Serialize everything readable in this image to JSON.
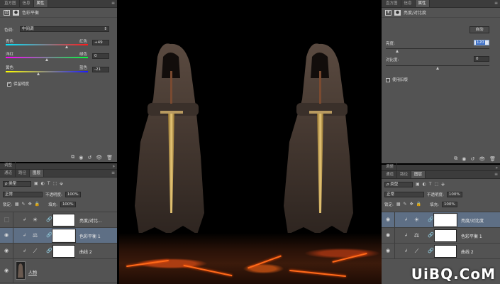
{
  "left_properties": {
    "tabs": [
      "直方图",
      "信息",
      "属性"
    ],
    "header": "色彩平衡",
    "tone_label": "色调:",
    "tone_value": "中间调",
    "sliders": [
      {
        "left": "青色",
        "right": "红色",
        "value": "+49",
        "level": 0.75
      },
      {
        "left": "洋红",
        "right": "绿色",
        "value": "0",
        "level": 0.5
      },
      {
        "left": "黄色",
        "right": "蓝色",
        "value": "-21",
        "level": 0.4
      }
    ],
    "preserve_luminosity": "保留明度"
  },
  "left_layers": {
    "top_tabs": [
      "调整"
    ],
    "tabs": [
      "通道",
      "路径",
      "图层"
    ],
    "filter_kind": "ρ 类型",
    "blend_mode": "正常",
    "opacity_label": "不透明度:",
    "opacity_value": "100%",
    "lock_label": "锁定:",
    "fill_label": "填充:",
    "fill_value": "100%",
    "layers": [
      {
        "name": "亮度/对比...",
        "icon": "brightness-icon",
        "selected": false,
        "visible": false
      },
      {
        "name": "色彩平衡 1",
        "icon": "balance-icon",
        "selected": true,
        "visible": true
      },
      {
        "name": "曲线 2",
        "icon": "curves-icon",
        "selected": false,
        "visible": true
      },
      {
        "name": "人物",
        "icon": "photo",
        "selected": false,
        "visible": true
      }
    ]
  },
  "right_properties": {
    "tabs": [
      "直方图",
      "信息",
      "属性"
    ],
    "header": "亮度/对比度",
    "auto_button": "自动",
    "brightness_label": "亮度:",
    "brightness_value": "120",
    "contrast_label": "对比度:",
    "contrast_value": "0",
    "legacy_label": "使用旧版"
  },
  "right_layers": {
    "top_tabs": [
      "调整"
    ],
    "tabs": [
      "通道",
      "路径",
      "图层"
    ],
    "filter_kind": "ρ 类型",
    "blend_mode": "正常",
    "opacity_label": "不透明度:",
    "opacity_value": "100%",
    "lock_label": "锁定:",
    "fill_label": "填充:",
    "fill_value": "100%",
    "layers": [
      {
        "name": "亮度/对比度",
        "icon": "brightness-icon",
        "selected": true,
        "visible": true
      },
      {
        "name": "色彩平衡 1",
        "icon": "balance-icon",
        "selected": false,
        "visible": true
      },
      {
        "name": "曲线 2",
        "icon": "curves-icon",
        "selected": false,
        "visible": true
      }
    ]
  },
  "watermark": "UiBQ.CoM",
  "colors": {
    "panel": "#535353",
    "selected_row": "#5e6f85",
    "lava": "#ff6a1a"
  }
}
